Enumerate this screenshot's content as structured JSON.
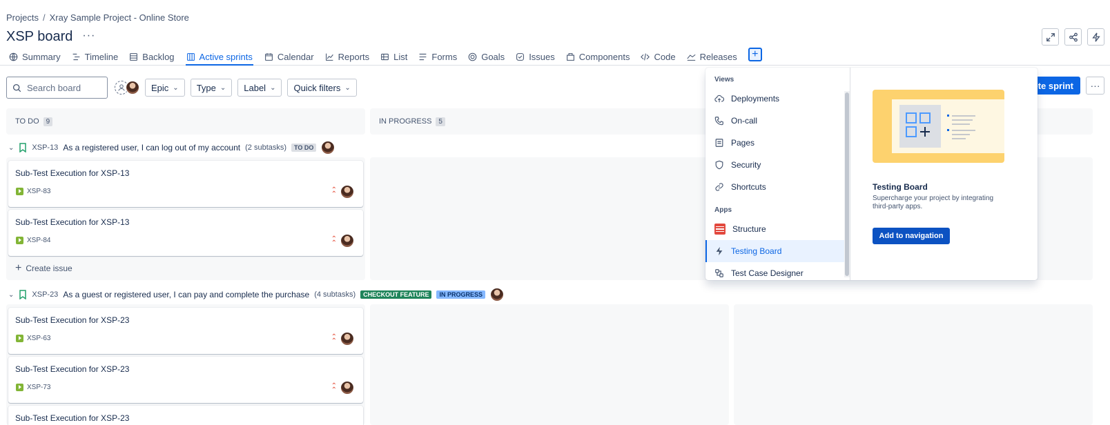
{
  "breadcrumb": {
    "projects": "Projects",
    "sep": "/",
    "project": "Xray Sample Project - Online Store"
  },
  "page": {
    "title": "XSP board",
    "more": "···"
  },
  "tabs": [
    {
      "label": "Summary",
      "icon": "globe-icon"
    },
    {
      "label": "Timeline",
      "icon": "timeline-icon"
    },
    {
      "label": "Backlog",
      "icon": "backlog-icon"
    },
    {
      "label": "Active sprints",
      "icon": "board-icon",
      "active": true
    },
    {
      "label": "Calendar",
      "icon": "calendar-icon"
    },
    {
      "label": "Reports",
      "icon": "chart-icon"
    },
    {
      "label": "List",
      "icon": "list-icon"
    },
    {
      "label": "Forms",
      "icon": "forms-icon"
    },
    {
      "label": "Goals",
      "icon": "goals-icon"
    },
    {
      "label": "Issues",
      "icon": "issues-icon"
    },
    {
      "label": "Components",
      "icon": "components-icon"
    },
    {
      "label": "Code",
      "icon": "code-icon"
    },
    {
      "label": "Releases",
      "icon": "releases-icon"
    }
  ],
  "tab_add": "+",
  "toolbar": {
    "search_placeholder": "Search board",
    "filters": [
      "Epic",
      "Type",
      "Label",
      "Quick filters"
    ],
    "complete_sprint": "plete sprint",
    "more": "···"
  },
  "columns": [
    {
      "name": "TO DO",
      "count": "9"
    },
    {
      "name": "IN PROGRESS",
      "count": "5"
    }
  ],
  "swimlanes": [
    {
      "key": "XSP-13",
      "title": "As a registered user, I can log out of my account",
      "subtasks": "(2 subtasks)",
      "badges": [
        {
          "text": "TO DO",
          "style": "grey"
        }
      ],
      "cards": [
        {
          "summary": "Sub-Test Execution for XSP-13",
          "key": "XSP-83"
        },
        {
          "summary": "Sub-Test Execution for XSP-13",
          "key": "XSP-84"
        }
      ]
    },
    {
      "key": "XSP-23",
      "title": "As a guest or registered user, I can pay and complete the purchase",
      "subtasks": "(4 subtasks)",
      "badges": [
        {
          "text": "CHECKOUT FEATURE",
          "style": "green"
        },
        {
          "text": "IN PROGRESS",
          "style": "blue"
        }
      ],
      "cards": [
        {
          "summary": "Sub-Test Execution for XSP-23",
          "key": "XSP-63"
        },
        {
          "summary": "Sub-Test Execution for XSP-23",
          "key": "XSP-73"
        },
        {
          "summary": "Sub-Test Execution for XSP-23",
          "key": ""
        }
      ]
    }
  ],
  "create_issue": "Create issue",
  "dropdown": {
    "views_label": "Views",
    "views": [
      {
        "label": "Deployments",
        "icon": "cloud-upload-icon"
      },
      {
        "label": "On-call",
        "icon": "phone-icon"
      },
      {
        "label": "Pages",
        "icon": "page-icon"
      },
      {
        "label": "Security",
        "icon": "shield-icon"
      },
      {
        "label": "Shortcuts",
        "icon": "link-icon"
      }
    ],
    "apps_label": "Apps",
    "apps": [
      {
        "label": "Structure",
        "icon": "structure-icon"
      },
      {
        "label": "Testing Board",
        "icon": "bolt-icon",
        "selected": true
      },
      {
        "label": "Test Case Designer",
        "icon": "test-designer-icon"
      }
    ],
    "preview": {
      "title": "Testing Board",
      "description": "Supercharge your project by integrating third-party apps.",
      "button": "Add to navigation"
    }
  },
  "colors": {
    "accent": "#0c66e4",
    "green_badge": "#1f845a",
    "blue_badge": "#85b8ff",
    "priority": "#e34935"
  }
}
